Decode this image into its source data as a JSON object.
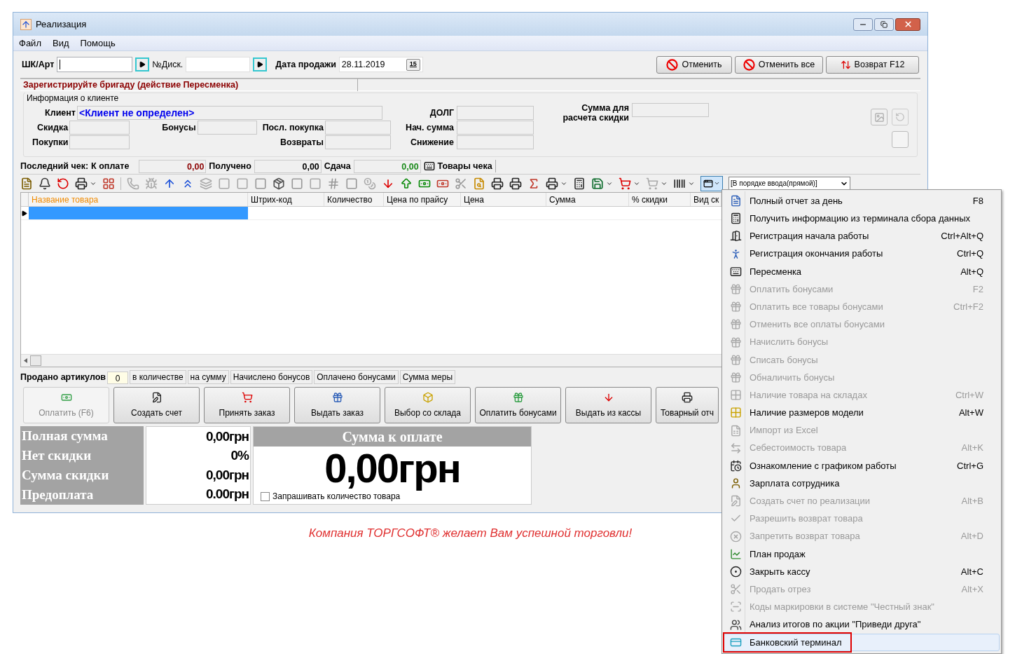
{
  "window": {
    "title": "Реализация",
    "menu": [
      "Файл",
      "Вид",
      "Помощь"
    ]
  },
  "search_bar": {
    "barcode_label": "ШК/Арт",
    "card_label": "№Диск.",
    "date_label": "Дата продажи",
    "date_value": "28.11.2019",
    "calendar_day": "15",
    "buttons": [
      {
        "label": "Отменить",
        "kind": "cancel"
      },
      {
        "label": "Отменить все",
        "kind": "cancel"
      },
      {
        "label": "Возврат F12",
        "kind": "return"
      }
    ]
  },
  "warning": "Зарегистрируйте бригаду (действие Пересменка)",
  "client_info": {
    "title": "Информация о клиенте",
    "client_label": "Клиент",
    "client_value": "<Клиент не определен>",
    "discount_label": "Скидка",
    "bonuses_label": "Бонусы",
    "last_purchase_label": "Посл. покупка",
    "purchases_label": "Покупки",
    "returns_label": "Возвраты",
    "debt_label": "ДОЛГ",
    "start_sum_label": "Нач. сумма",
    "reduction_label": "Снижение",
    "discount_base_label": "Сумма для расчета скидки"
  },
  "last_check": {
    "label": "Последний чек:",
    "to_pay_label": "К оплате",
    "to_pay": "0,00",
    "received_label": "Получено",
    "received": "0,00",
    "change_label": "Сдача",
    "change": "0,00",
    "items_label": "Товары чека"
  },
  "toolbar": {
    "sort_order": "[В порядке ввода(прямой)]"
  },
  "table": {
    "columns": [
      "Название товара",
      "Штрих-код",
      "Количество",
      "Цена по прайсу",
      "Цена",
      "Сумма",
      "% скидки",
      "Вид ск"
    ],
    "rows": [
      {
        "selected": true
      }
    ]
  },
  "summary": {
    "sold_label": "Продано артикулов",
    "sold_value": "0",
    "cells": [
      "в количестве",
      "на сумму",
      "Начислено бонусов",
      "Оплачено бонусами",
      "Сумма меры"
    ]
  },
  "actions": [
    {
      "label": "Оплатить (F6)",
      "disabled": true
    },
    {
      "label": "Создать счет",
      "disabled": false
    },
    {
      "label": "Принять заказ",
      "disabled": false
    },
    {
      "label": "Выдать заказ",
      "disabled": false
    },
    {
      "label": "Выбор со склада",
      "disabled": false
    },
    {
      "label": "Оплатить бонусами",
      "disabled": false
    },
    {
      "label": "Выдать из кассы",
      "disabled": false
    },
    {
      "label": "Товарный отч",
      "disabled": false
    }
  ],
  "totals": {
    "rows": [
      {
        "label": "Полная сумма",
        "value": "0,00грн"
      },
      {
        "label": "Нет скидки",
        "value": "0%"
      },
      {
        "label": "Сумма скидки",
        "value": "0,00грн"
      },
      {
        "label": "Предоплата",
        "value": "0.00грн"
      }
    ],
    "to_pay_title": "Сумма к оплате",
    "to_pay_value": "0,00грн",
    "ask_quantity": {
      "label": "Запрашивать количество товара",
      "checked": false
    }
  },
  "slogan": "Компания ТОРГСОФТ® желает Вам успешной торговли!",
  "context_menu": [
    {
      "label": "Полный отчет за день",
      "shortcut": "F8",
      "disabled": false,
      "selected": false
    },
    {
      "label": "Получить информацию из терминала сбора данных",
      "disabled": false,
      "selected": false
    },
    {
      "label": "Регистрация начала работы",
      "shortcut": "Ctrl+Alt+Q",
      "disabled": false,
      "selected": false
    },
    {
      "label": "Регистрация окончания работы",
      "shortcut": "Ctrl+Q",
      "disabled": false,
      "selected": false
    },
    {
      "label": "Пересменка",
      "shortcut": "Alt+Q",
      "disabled": false,
      "selected": false
    },
    {
      "label": "Оплатить бонусами",
      "shortcut": "F2",
      "disabled": true,
      "selected": false
    },
    {
      "label": "Оплатить все товары бонусами",
      "shortcut": "Ctrl+F2",
      "disabled": true,
      "selected": false
    },
    {
      "label": "Отменить все оплаты бонусами",
      "disabled": true,
      "selected": false
    },
    {
      "label": "Начислить бонусы",
      "disabled": true,
      "selected": false
    },
    {
      "label": "Списать бонусы",
      "disabled": true,
      "selected": false
    },
    {
      "label": "Обналичить бонусы",
      "disabled": true,
      "selected": false
    },
    {
      "label": "Наличие товара на складах",
      "shortcut": "Ctrl+W",
      "disabled": true,
      "selected": false
    },
    {
      "label": "Наличие размеров модели",
      "shortcut": "Alt+W",
      "disabled": false,
      "selected": false
    },
    {
      "label": "Импорт из Excel",
      "disabled": true,
      "selected": false
    },
    {
      "label": "Себестоимость товара",
      "shortcut": "Alt+K",
      "disabled": true,
      "selected": false
    },
    {
      "label": "Ознакомление с графиком работы",
      "shortcut": "Ctrl+G",
      "disabled": false,
      "selected": false
    },
    {
      "label": "Зарплата сотрудника",
      "disabled": false,
      "selected": false
    },
    {
      "label": "Создать счет по реализации",
      "shortcut": "Alt+B",
      "disabled": true,
      "selected": false
    },
    {
      "label": "Разрешить возврат товара",
      "disabled": true,
      "selected": false
    },
    {
      "label": "Запретить возврат товара",
      "shortcut": "Alt+D",
      "disabled": true,
      "selected": false
    },
    {
      "label": "План продаж",
      "disabled": false,
      "selected": false
    },
    {
      "label": "Закрыть кассу",
      "shortcut": "Alt+C",
      "disabled": false,
      "selected": false
    },
    {
      "label": "Продать отрез",
      "shortcut": "Alt+X",
      "disabled": true,
      "selected": false
    },
    {
      "label": "Коды маркировки в системе \"Честный знак\"",
      "disabled": true,
      "selected": false
    },
    {
      "label": "Анализ итогов по акции \"Приведи друга\"",
      "disabled": false,
      "selected": false
    },
    {
      "label": "Банковский терминал",
      "disabled": false,
      "selected": true
    }
  ]
}
